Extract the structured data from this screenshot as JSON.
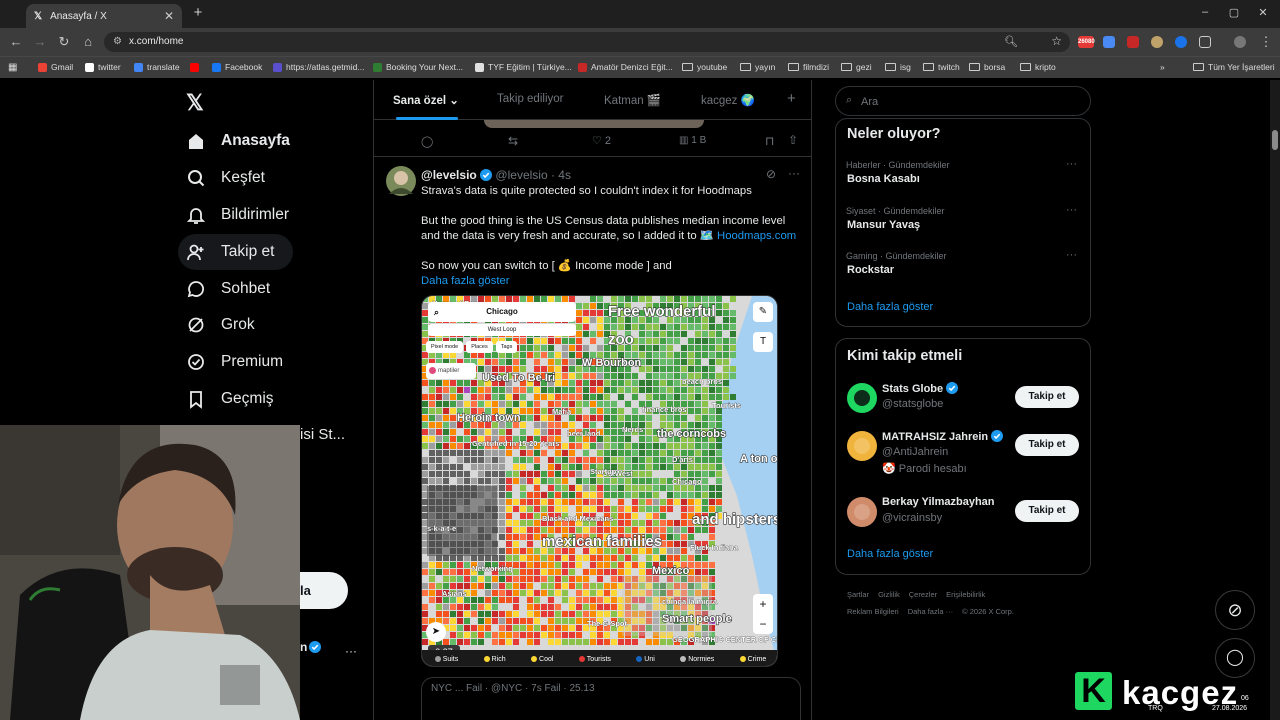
{
  "browser": {
    "tab_title": "Anasayfa / X",
    "url": "x.com/home",
    "new_tab": "+",
    "close_tab": "✕",
    "window_controls": {
      "minimize": "–",
      "maximize": "▢",
      "close": "✕"
    },
    "extension_badge": "26080",
    "bookmarks": [
      {
        "label": "Gmail",
        "color": "#ea4335"
      },
      {
        "label": "twitter",
        "color": "#ffffff"
      },
      {
        "label": "translate",
        "color": "#4285f4"
      },
      {
        "label": "",
        "color": "#ff0000"
      },
      {
        "label": "Facebook",
        "color": "#1877f2"
      },
      {
        "label": "https://atlas.getmid...",
        "color": "#5a4fcf"
      },
      {
        "label": "Booking Your Next...",
        "color": "#2e7d32"
      },
      {
        "label": "TYF Eğitim | Türkiye...",
        "color": "#e0e0e0"
      },
      {
        "label": "Amatör Denizci Eğit...",
        "color": "#c62828"
      }
    ],
    "bookmark_folders": [
      "youtube",
      "yayın",
      "filmdizi",
      "gezi",
      "isg",
      "twitch",
      "borsa",
      "kripto"
    ],
    "all_bookmarks": "Tüm Yer İşaretleri",
    "more": "»"
  },
  "nav": {
    "items": [
      {
        "label": "Anasayfa",
        "icon": "home-icon"
      },
      {
        "label": "Keşfet",
        "icon": "search-icon"
      },
      {
        "label": "Bildirimler",
        "icon": "bell-icon"
      },
      {
        "label": "Takip et",
        "icon": "follow-icon"
      },
      {
        "label": "Sohbet",
        "icon": "chat-icon"
      },
      {
        "label": "Grok",
        "icon": "grok-icon"
      },
      {
        "label": "Premium",
        "icon": "premium-icon"
      },
      {
        "label": "Geçmiş",
        "icon": "bookmark-icon"
      }
    ],
    "partial_item": "isi St...",
    "post_button_partial": "la",
    "profile_more": "···"
  },
  "feed": {
    "tabs": [
      "Sana özel",
      "Takip ediliyor",
      "Katman 🎬",
      "kacgez 🌍"
    ],
    "add_tab": "+",
    "prev_post_actions": {
      "likes": "2",
      "views": "1 B"
    },
    "post": {
      "display_name": "@levelsio",
      "handle": "@levelsio",
      "time": "· 4s",
      "text1": "Strava's data is quite protected so I couldn't index it for Hoodmaps",
      "text2": "But the good thing is the US Census data publishes median income level and the data is very fresh and accurate, so I added it to 🗺️ ",
      "link": "Hoodmaps.com",
      "text3": "So now you can switch to [ 💰 Income mode ] and",
      "show_more": "Daha fazla göster",
      "video_time": "0:37"
    },
    "map": {
      "search": "Chicago",
      "area": "West Loop",
      "chips": [
        "Pixel mode",
        "Places",
        "Tags"
      ],
      "brand": "maptiler",
      "labels": [
        {
          "text": "Free wonderful",
          "size": "lg"
        },
        {
          "text": "zoo",
          "size": "lg"
        },
        {
          "text": "W Bourbon",
          "size": "md"
        },
        {
          "text": "Used To Be Iri",
          "size": "md"
        },
        {
          "text": "beach bros",
          "size": "sm"
        },
        {
          "text": "Tourists",
          "size": "sm"
        },
        {
          "text": "Heroin town",
          "size": "md"
        },
        {
          "text": "finance bros",
          "size": "sm"
        },
        {
          "text": "Mafia",
          "size": "sm"
        },
        {
          "text": "Nerds",
          "size": "sm"
        },
        {
          "text": "beer land",
          "size": "sm"
        },
        {
          "text": "the corncobs",
          "size": "md"
        },
        {
          "text": "Gentrified in 15-20 Years",
          "size": "sm"
        },
        {
          "text": "D'arts",
          "size": "sm"
        },
        {
          "text": "A ton o",
          "size": "md"
        },
        {
          "text": "OutWest",
          "size": "sm"
        },
        {
          "text": "Startup",
          "size": "sm"
        },
        {
          "text": "Chicago",
          "size": "sm"
        },
        {
          "text": "s-k-a-t-e",
          "size": "sm"
        },
        {
          "text": "Black and Mexicans",
          "size": "sm"
        },
        {
          "text": "mexican families",
          "size": "lg"
        },
        {
          "text": "and hipsters",
          "size": "lg"
        },
        {
          "text": "Fluck Indiana",
          "size": "sm"
        },
        {
          "text": "Networking",
          "size": "sm"
        },
        {
          "text": "Mexico",
          "size": "md"
        },
        {
          "text": "Asians",
          "size": "sm"
        },
        {
          "text": "chinga la migra",
          "size": "sm"
        },
        {
          "text": "Smart people",
          "size": "md"
        },
        {
          "text": "The G Spot",
          "size": "sm"
        },
        {
          "text": "GEOGRAPHIC CENTER OF CHICAGO",
          "size": "sm"
        },
        {
          "text": "Home of Beers",
          "size": "sm"
        }
      ],
      "legend": [
        "Suits",
        "Rich",
        "Cool",
        "Tourists",
        "Uni",
        "Normies",
        "Crime"
      ],
      "zoom_in": "+",
      "zoom_out": "−"
    },
    "next_post_partial": "NYC ... Fail · @NYC · 7s Fail · 25.13"
  },
  "right": {
    "search_placeholder": "Ara",
    "trends_title": "Neler oluyor?",
    "trends": [
      {
        "meta": "Haberler · Gündemdekiler",
        "name": "Bosna Kasabı"
      },
      {
        "meta": "Siyaset · Gündemdekiler",
        "name": "Mansur Yavaş"
      },
      {
        "meta": "Gaming · Gündemdekiler",
        "name": "Rockstar"
      }
    ],
    "show_more": "Daha fazla göster",
    "who_title": "Kimi takip etmeli",
    "who": [
      {
        "name": "Stats Globe",
        "handle": "@statsglobe",
        "verified": true,
        "note": ""
      },
      {
        "name": "MATRAHSIZ Jahrein",
        "handle": "@AntiJahrein",
        "verified": true,
        "note": "🤡 Parodi hesabı"
      },
      {
        "name": "Berkay Yilmazbayhan",
        "handle": "@vicrainsby",
        "verified": false,
        "note": ""
      }
    ],
    "follow_label": "Takip et",
    "footer1": [
      "Şartlar",
      "Gizlilik",
      "Çerezler",
      "Erişilebilirlik"
    ],
    "footer2": [
      "Reklam Bilgileri",
      "Daha fazla ···",
      "© 2026 X Corp."
    ]
  },
  "overlay": {
    "watermark": "kacgez",
    "watermark_logo_letter": "K",
    "taskbar_lang": "TRQ",
    "taskbar_time": "06",
    "taskbar_date": "27.08.2026"
  },
  "colors": {
    "accent": "#1d9bf0",
    "brand_green": "#1ed760",
    "background": "#000000"
  }
}
